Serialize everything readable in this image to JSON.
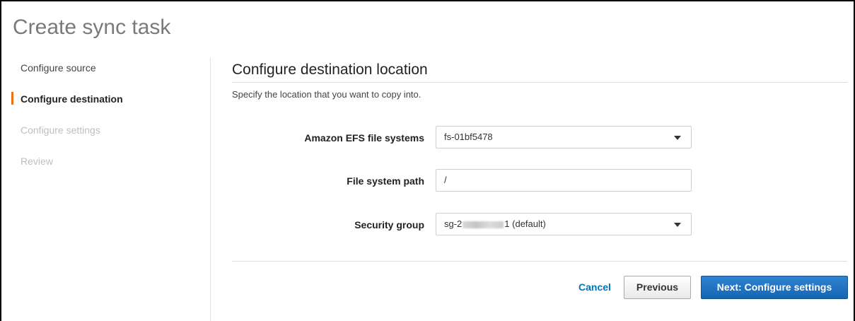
{
  "page": {
    "title": "Create sync task"
  },
  "steps": [
    {
      "label": "Configure source",
      "state": "completed"
    },
    {
      "label": "Configure destination",
      "state": "active"
    },
    {
      "label": "Configure settings",
      "state": "disabled"
    },
    {
      "label": "Review",
      "state": "disabled"
    }
  ],
  "main": {
    "title": "Configure destination location",
    "description": "Specify the location that you want to copy into.",
    "fields": {
      "efs": {
        "label": "Amazon EFS file systems",
        "value": "fs-01bf5478"
      },
      "path": {
        "label": "File system path",
        "value": "/"
      },
      "security_group": {
        "label": "Security group",
        "prefix": "sg-2",
        "suffix": "1 (default)"
      }
    }
  },
  "footer": {
    "cancel": "Cancel",
    "previous": "Previous",
    "next": "Next: Configure settings"
  },
  "colors": {
    "accent": "#ec7211",
    "primary_button": "#1a6fc2",
    "link": "#0073bb",
    "disabled_text": "#bfbfbf"
  },
  "icons": {
    "dropdown": "caret-down-icon"
  }
}
